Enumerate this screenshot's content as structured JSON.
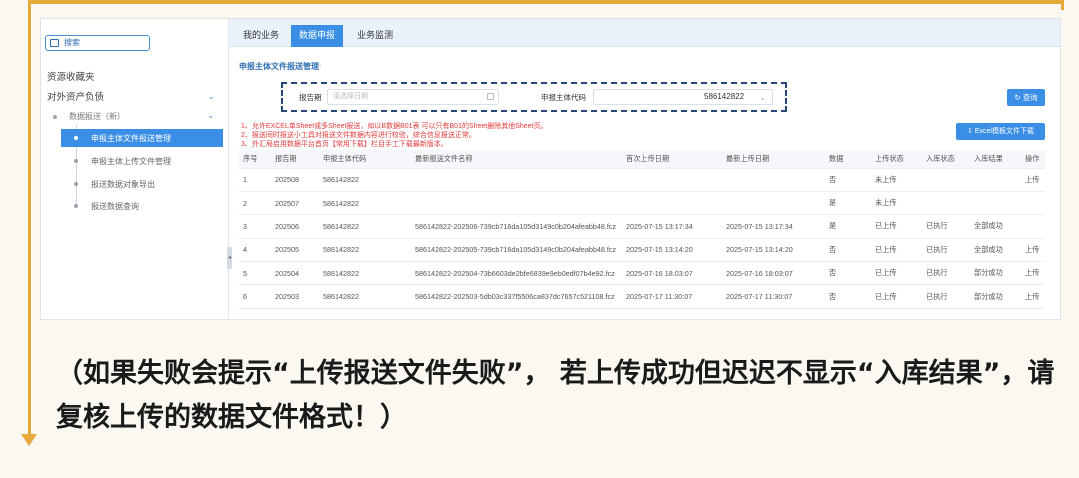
{
  "sidebar": {
    "search_label": "搜索",
    "menu_1": "资源收藏夹",
    "menu_2": "对外资产负债",
    "sub_parent": "数据报送（新）",
    "items": [
      {
        "label": "申报主体文件报送管理",
        "active": true
      },
      {
        "label": "申报主体上传文件管理",
        "active": false
      },
      {
        "label": "报送数据对象导出",
        "active": false
      },
      {
        "label": "报送数据查询",
        "active": false
      }
    ]
  },
  "tabs": [
    "我的业务",
    "数据申报",
    "业务监测"
  ],
  "panel": {
    "title": "申报主体文件报送管理",
    "filter": {
      "period_label": "报告期",
      "period_placeholder": "请选择日期",
      "entity_label": "申报主体代码",
      "entity_value": "586142822"
    },
    "query_button": "查询",
    "excel_button": "Excel模板文件下载",
    "notes": [
      "1、允许EXCEL单Sheet或多Sheet报送，如以B数据B01表 可以只有B01的Sheet删除其他Sheet页。",
      "2、报送同时报送小工具对报送文件数据内容进行校验，综合信息报送正常。",
      "3、外汇局启用数据平台首页【常用下载】栏目手工下载最新版本。"
    ]
  },
  "table": {
    "headers": [
      "序号",
      "报告期",
      "申报主体代码",
      "最新报送文件名称",
      "首次上传日期",
      "最新上传日期",
      "数据",
      "上传状态",
      "入库状态",
      "入库结果",
      "操作"
    ],
    "rows": [
      {
        "no": "1",
        "period": "202508",
        "code": "586142822",
        "file": "",
        "first": "",
        "latest": "",
        "flag": "否",
        "upload": "未上传",
        "store": "",
        "result": "",
        "op": "上传"
      },
      {
        "no": "2",
        "period": "202507",
        "code": "586142822",
        "file": "",
        "first": "",
        "latest": "",
        "flag": "是",
        "upload": "未上传",
        "store": "",
        "result": "",
        "op": ""
      },
      {
        "no": "3",
        "period": "202506",
        "code": "586142822",
        "file": "586142822-202506-739cb716da105d3149c0b204afeabb48.fcz",
        "first": "2025-07-15 13:17:34",
        "latest": "2025-07-15 13:17:34",
        "flag": "是",
        "upload": "已上传",
        "store": "已执行",
        "result": "全部成功",
        "op": ""
      },
      {
        "no": "4",
        "period": "202505",
        "code": "586142822",
        "file": "586142822-202505-739cb716da105d3149c0b204afeabb48.fcz",
        "first": "2025-07-15 13:14:20",
        "latest": "2025-07-15 13:14:20",
        "flag": "否",
        "upload": "已上传",
        "store": "已执行",
        "result": "全部成功",
        "op": "上传"
      },
      {
        "no": "5",
        "period": "202504",
        "code": "586142822",
        "file": "586142822-202504-73b6603de2bfe6839e9eb0edf07b4e92.fcz",
        "first": "2025-07-16 18:03:07",
        "latest": "2025-07-16 18:03:07",
        "flag": "否",
        "upload": "已上传",
        "store": "已执行",
        "result": "部分成功",
        "op": "上传"
      },
      {
        "no": "6",
        "period": "202503",
        "code": "586142822",
        "file": "586142822-202503-5db03c337f5506ca837dc7657c521108.fcz",
        "first": "2025-07-17 11:30:07",
        "latest": "2025-07-17 11:30:07",
        "flag": "否",
        "upload": "已上传",
        "store": "已执行",
        "result": "部分成功",
        "op": "上传"
      }
    ]
  },
  "caption": "（如果失败会提示“上传报送文件失败”， 若上传成功但迟迟不显示“入库结果”，请复核上传的数据文件格式！）",
  "colors": {
    "accent": "#3a8ee6",
    "frame": "#e6a93a",
    "error": "#e23b3b",
    "success": "#2aa248"
  }
}
